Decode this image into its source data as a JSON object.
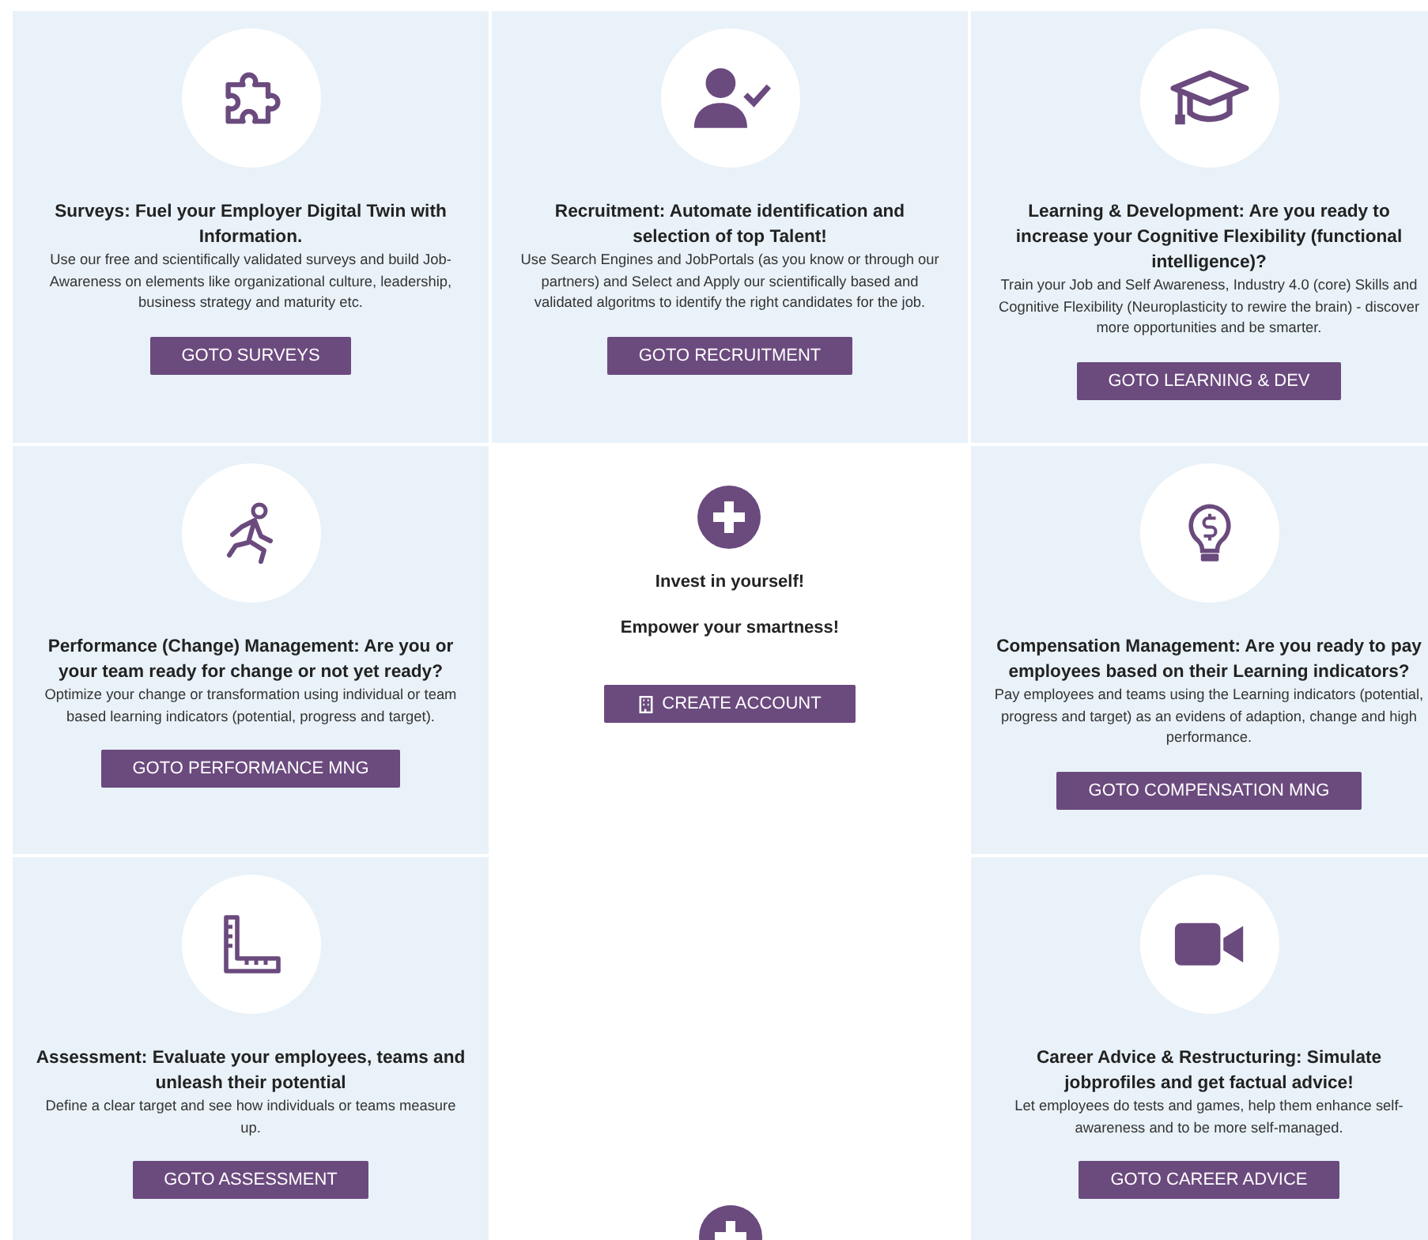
{
  "cards": [
    {
      "title": "Surveys: Fuel your Employer Digital Twin with Information.",
      "text": "Use our free and scientifically validated surveys and build Job-Awareness on elements like organizational culture, leadership, business strategy and maturity etc.",
      "button": "GOTO SURVEYS"
    },
    {
      "title": "Recruitment: Automate identification and selection of top Talent!",
      "text": "Use Search Engines and JobPortals (as you know or through our partners) and Select and Apply our scientifically based and validated algoritms to identify the right candidates for the job.",
      "button": "GOTO RECRUITMENT"
    },
    {
      "title": "Learning & Development: Are you ready to increase your Cognitive Flexibility (functional intelligence)?",
      "text": "Train your Job and Self Awareness, Industry 4.0 (core) Skills and Cognitive Flexibility (Neuroplasticity to rewire the brain) - discover more opportunities and be smarter.",
      "button": "GOTO LEARNING & DEV"
    },
    {
      "title": "Performance (Change) Management: Are you or your team ready for change or not yet ready?",
      "text": "Optimize your change or transformation using individual or team based learning indicators (potential, progress and target).",
      "button": "GOTO PERFORMANCE MNG"
    },
    {
      "title": "Compensation Management: Are you ready to pay employees based on their Learning indicators?",
      "text": "Pay employees and teams using the Learning indicators (potential, progress and target) as an evidens of adaption, change and high performance.",
      "button": "GOTO COMPENSATION MNG"
    },
    {
      "title": "Assessment: Evaluate your employees, teams and unleash their potential",
      "text": "Define a clear target and see how individuals or teams measure up.",
      "button": "GOTO ASSESSMENT"
    },
    {
      "title": "Career Advice & Restructuring: Simulate jobprofiles and get factual advice!",
      "text": "Let employees do tests and games, help them enhance self-awareness and to be more self-managed.",
      "button": "GOTO CAREER ADVICE"
    }
  ],
  "promo": {
    "lines": [
      "Invest in yourself!",
      "Empower your smartness!"
    ],
    "button": "CREATE ACCOUNT"
  }
}
